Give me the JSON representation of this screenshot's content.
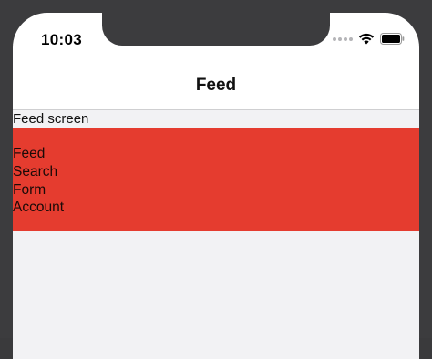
{
  "status_bar": {
    "time": "10:03",
    "icons": [
      "signal-dots-icon",
      "wifi-icon",
      "battery-icon"
    ]
  },
  "nav": {
    "title": "Feed"
  },
  "content": {
    "screen_label": "Feed screen",
    "menu_items": [
      {
        "label": "Feed"
      },
      {
        "label": "Search"
      },
      {
        "label": "Form"
      },
      {
        "label": "Account"
      }
    ]
  },
  "colors": {
    "menu_panel": "#e53c2f",
    "background": "#f2f2f4",
    "frame": "#3c3c3e"
  }
}
